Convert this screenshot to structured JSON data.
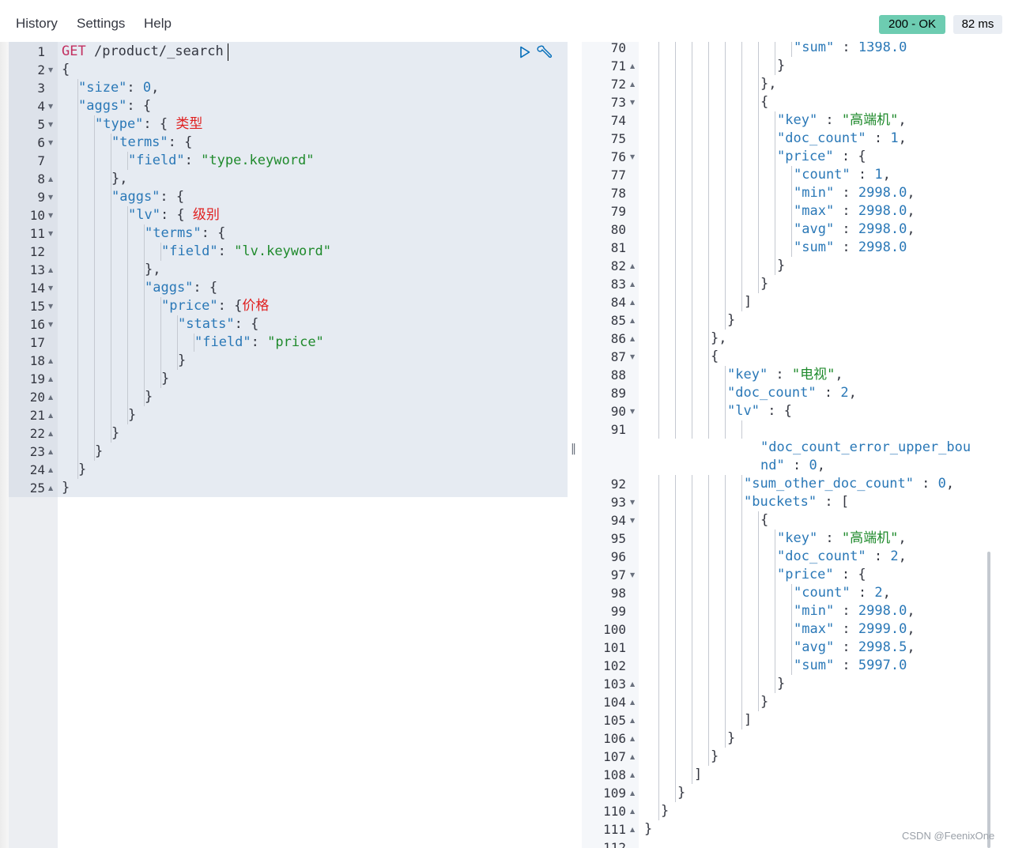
{
  "menu": {
    "history": "History",
    "settings": "Settings",
    "help": "Help"
  },
  "status": {
    "code_text": "200 - OK",
    "time_text": "82 ms"
  },
  "watermark": "CSDN @FeenixOne",
  "request": {
    "lines": [
      {
        "n": "1",
        "fold": "",
        "ind": 0,
        "tokens": [
          [
            "m",
            "GET"
          ],
          [
            "p",
            " "
          ],
          [
            "url",
            "/product/_search"
          ]
        ]
      },
      {
        "n": "2",
        "fold": "open",
        "ind": 0,
        "tokens": [
          [
            "p",
            "{"
          ]
        ]
      },
      {
        "n": "3",
        "fold": "",
        "ind": 1,
        "tokens": [
          [
            "k",
            "\"size\""
          ],
          [
            "p",
            ": "
          ],
          [
            "n",
            "0"
          ],
          [
            "p",
            ","
          ]
        ]
      },
      {
        "n": "4",
        "fold": "open",
        "ind": 1,
        "tokens": [
          [
            "k",
            "\"aggs\""
          ],
          [
            "p",
            ": {"
          ]
        ]
      },
      {
        "n": "5",
        "fold": "open",
        "ind": 2,
        "tokens": [
          [
            "k",
            "\"type\""
          ],
          [
            "p",
            ": { "
          ],
          [
            "cn",
            "类型"
          ]
        ]
      },
      {
        "n": "6",
        "fold": "open",
        "ind": 3,
        "tokens": [
          [
            "k",
            "\"terms\""
          ],
          [
            "p",
            ": {"
          ]
        ]
      },
      {
        "n": "7",
        "fold": "",
        "ind": 4,
        "tokens": [
          [
            "k",
            "\"field\""
          ],
          [
            "p",
            ": "
          ],
          [
            "s",
            "\"type.keyword\""
          ]
        ]
      },
      {
        "n": "8",
        "fold": "close",
        "ind": 3,
        "tokens": [
          [
            "p",
            "},"
          ]
        ]
      },
      {
        "n": "9",
        "fold": "open",
        "ind": 3,
        "tokens": [
          [
            "k",
            "\"aggs\""
          ],
          [
            "p",
            ": {"
          ]
        ]
      },
      {
        "n": "10",
        "fold": "open",
        "ind": 4,
        "tokens": [
          [
            "k",
            "\"lv\""
          ],
          [
            "p",
            ": { "
          ],
          [
            "cn",
            "级别"
          ]
        ]
      },
      {
        "n": "11",
        "fold": "open",
        "ind": 5,
        "tokens": [
          [
            "k",
            "\"terms\""
          ],
          [
            "p",
            ": {"
          ]
        ]
      },
      {
        "n": "12",
        "fold": "",
        "ind": 6,
        "tokens": [
          [
            "k",
            "\"field\""
          ],
          [
            "p",
            ": "
          ],
          [
            "s",
            "\"lv.keyword\""
          ]
        ]
      },
      {
        "n": "13",
        "fold": "close",
        "ind": 5,
        "tokens": [
          [
            "p",
            "},"
          ]
        ]
      },
      {
        "n": "14",
        "fold": "open",
        "ind": 5,
        "tokens": [
          [
            "k",
            "\"aggs\""
          ],
          [
            "p",
            ": {"
          ]
        ]
      },
      {
        "n": "15",
        "fold": "open",
        "ind": 6,
        "tokens": [
          [
            "k",
            "\"price\""
          ],
          [
            "p",
            ": {"
          ],
          [
            "cn",
            "价格"
          ]
        ]
      },
      {
        "n": "16",
        "fold": "open",
        "ind": 7,
        "tokens": [
          [
            "k",
            "\"stats\""
          ],
          [
            "p",
            ": {"
          ]
        ]
      },
      {
        "n": "17",
        "fold": "",
        "ind": 8,
        "tokens": [
          [
            "k",
            "\"field\""
          ],
          [
            "p",
            ": "
          ],
          [
            "s",
            "\"price\""
          ]
        ]
      },
      {
        "n": "18",
        "fold": "close",
        "ind": 7,
        "tokens": [
          [
            "p",
            "}"
          ]
        ]
      },
      {
        "n": "19",
        "fold": "close",
        "ind": 6,
        "tokens": [
          [
            "p",
            "}"
          ]
        ]
      },
      {
        "n": "20",
        "fold": "close",
        "ind": 5,
        "tokens": [
          [
            "p",
            "}"
          ]
        ]
      },
      {
        "n": "21",
        "fold": "close",
        "ind": 4,
        "tokens": [
          [
            "p",
            "}"
          ]
        ]
      },
      {
        "n": "22",
        "fold": "close",
        "ind": 3,
        "tokens": [
          [
            "p",
            "}"
          ]
        ]
      },
      {
        "n": "23",
        "fold": "close",
        "ind": 2,
        "tokens": [
          [
            "p",
            "}"
          ]
        ]
      },
      {
        "n": "24",
        "fold": "close",
        "ind": 1,
        "tokens": [
          [
            "p",
            "}"
          ]
        ]
      },
      {
        "n": "25",
        "fold": "close",
        "ind": 0,
        "tokens": [
          [
            "p",
            "}"
          ]
        ]
      }
    ]
  },
  "response": {
    "lines": [
      {
        "n": "70",
        "fold": "",
        "ind": 9,
        "tokens": [
          [
            "k",
            "\"sum\""
          ],
          [
            "p",
            " : "
          ],
          [
            "n",
            "1398.0"
          ]
        ]
      },
      {
        "n": "71",
        "fold": "close",
        "ind": 8,
        "tokens": [
          [
            "p",
            "}"
          ]
        ]
      },
      {
        "n": "72",
        "fold": "close",
        "ind": 7,
        "tokens": [
          [
            "p",
            "},"
          ]
        ]
      },
      {
        "n": "73",
        "fold": "open",
        "ind": 7,
        "tokens": [
          [
            "p",
            "{"
          ]
        ]
      },
      {
        "n": "74",
        "fold": "",
        "ind": 8,
        "tokens": [
          [
            "k",
            "\"key\""
          ],
          [
            "p",
            " : "
          ],
          [
            "s",
            "\"高端机\""
          ],
          [
            "p",
            ","
          ]
        ]
      },
      {
        "n": "75",
        "fold": "",
        "ind": 8,
        "tokens": [
          [
            "k",
            "\"doc_count\""
          ],
          [
            "p",
            " : "
          ],
          [
            "n",
            "1"
          ],
          [
            "p",
            ","
          ]
        ]
      },
      {
        "n": "76",
        "fold": "open",
        "ind": 8,
        "tokens": [
          [
            "k",
            "\"price\""
          ],
          [
            "p",
            " : {"
          ]
        ]
      },
      {
        "n": "77",
        "fold": "",
        "ind": 9,
        "tokens": [
          [
            "k",
            "\"count\""
          ],
          [
            "p",
            " : "
          ],
          [
            "n",
            "1"
          ],
          [
            "p",
            ","
          ]
        ]
      },
      {
        "n": "78",
        "fold": "",
        "ind": 9,
        "tokens": [
          [
            "k",
            "\"min\""
          ],
          [
            "p",
            " : "
          ],
          [
            "n",
            "2998.0"
          ],
          [
            "p",
            ","
          ]
        ]
      },
      {
        "n": "79",
        "fold": "",
        "ind": 9,
        "tokens": [
          [
            "k",
            "\"max\""
          ],
          [
            "p",
            " : "
          ],
          [
            "n",
            "2998.0"
          ],
          [
            "p",
            ","
          ]
        ]
      },
      {
        "n": "80",
        "fold": "",
        "ind": 9,
        "tokens": [
          [
            "k",
            "\"avg\""
          ],
          [
            "p",
            " : "
          ],
          [
            "n",
            "2998.0"
          ],
          [
            "p",
            ","
          ]
        ]
      },
      {
        "n": "81",
        "fold": "",
        "ind": 9,
        "tokens": [
          [
            "k",
            "\"sum\""
          ],
          [
            "p",
            " : "
          ],
          [
            "n",
            "2998.0"
          ]
        ]
      },
      {
        "n": "82",
        "fold": "close",
        "ind": 8,
        "tokens": [
          [
            "p",
            "}"
          ]
        ]
      },
      {
        "n": "83",
        "fold": "close",
        "ind": 7,
        "tokens": [
          [
            "p",
            "}"
          ]
        ]
      },
      {
        "n": "84",
        "fold": "close",
        "ind": 6,
        "tokens": [
          [
            "p",
            "]"
          ]
        ]
      },
      {
        "n": "85",
        "fold": "close",
        "ind": 5,
        "tokens": [
          [
            "p",
            "}"
          ]
        ]
      },
      {
        "n": "86",
        "fold": "close",
        "ind": 4,
        "tokens": [
          [
            "p",
            "},"
          ]
        ]
      },
      {
        "n": "87",
        "fold": "open",
        "ind": 4,
        "tokens": [
          [
            "p",
            "{"
          ]
        ]
      },
      {
        "n": "88",
        "fold": "",
        "ind": 5,
        "tokens": [
          [
            "k",
            "\"key\""
          ],
          [
            "p",
            " : "
          ],
          [
            "s",
            "\"电视\""
          ],
          [
            "p",
            ","
          ]
        ]
      },
      {
        "n": "89",
        "fold": "",
        "ind": 5,
        "tokens": [
          [
            "k",
            "\"doc_count\""
          ],
          [
            "p",
            " : "
          ],
          [
            "n",
            "2"
          ],
          [
            "p",
            ","
          ]
        ]
      },
      {
        "n": "90",
        "fold": "open",
        "ind": 5,
        "tokens": [
          [
            "k",
            "\"lv\""
          ],
          [
            "p",
            " : {"
          ]
        ]
      },
      {
        "n": "91",
        "fold": "",
        "ind": 6,
        "tokens": [],
        "guides_only": true
      },
      {
        "n": "",
        "fold": "",
        "ind": 7,
        "tokens": [
          [
            "k",
            "\"doc_count_error_upper_bou"
          ]
        ],
        "noguide": true
      },
      {
        "n": "",
        "fold": "",
        "ind": 7,
        "tokens": [
          [
            "k",
            "nd\""
          ],
          [
            "p",
            " : "
          ],
          [
            "n",
            "0"
          ],
          [
            "p",
            ","
          ]
        ],
        "noguide": true
      },
      {
        "n": "92",
        "fold": "",
        "ind": 6,
        "tokens": [
          [
            "k",
            "\"sum_other_doc_count\""
          ],
          [
            "p",
            " : "
          ],
          [
            "n",
            "0"
          ],
          [
            "p",
            ","
          ]
        ]
      },
      {
        "n": "93",
        "fold": "open",
        "ind": 6,
        "tokens": [
          [
            "k",
            "\"buckets\""
          ],
          [
            "p",
            " : ["
          ]
        ]
      },
      {
        "n": "94",
        "fold": "open",
        "ind": 7,
        "tokens": [
          [
            "p",
            "{"
          ]
        ]
      },
      {
        "n": "95",
        "fold": "",
        "ind": 8,
        "tokens": [
          [
            "k",
            "\"key\""
          ],
          [
            "p",
            " : "
          ],
          [
            "s",
            "\"高端机\""
          ],
          [
            "p",
            ","
          ]
        ]
      },
      {
        "n": "96",
        "fold": "",
        "ind": 8,
        "tokens": [
          [
            "k",
            "\"doc_count\""
          ],
          [
            "p",
            " : "
          ],
          [
            "n",
            "2"
          ],
          [
            "p",
            ","
          ]
        ]
      },
      {
        "n": "97",
        "fold": "open",
        "ind": 8,
        "tokens": [
          [
            "k",
            "\"price\""
          ],
          [
            "p",
            " : {"
          ]
        ]
      },
      {
        "n": "98",
        "fold": "",
        "ind": 9,
        "tokens": [
          [
            "k",
            "\"count\""
          ],
          [
            "p",
            " : "
          ],
          [
            "n",
            "2"
          ],
          [
            "p",
            ","
          ]
        ]
      },
      {
        "n": "99",
        "fold": "",
        "ind": 9,
        "tokens": [
          [
            "k",
            "\"min\""
          ],
          [
            "p",
            " : "
          ],
          [
            "n",
            "2998.0"
          ],
          [
            "p",
            ","
          ]
        ]
      },
      {
        "n": "100",
        "fold": "",
        "ind": 9,
        "tokens": [
          [
            "k",
            "\"max\""
          ],
          [
            "p",
            " : "
          ],
          [
            "n",
            "2999.0"
          ],
          [
            "p",
            ","
          ]
        ]
      },
      {
        "n": "101",
        "fold": "",
        "ind": 9,
        "tokens": [
          [
            "k",
            "\"avg\""
          ],
          [
            "p",
            " : "
          ],
          [
            "n",
            "2998.5"
          ],
          [
            "p",
            ","
          ]
        ]
      },
      {
        "n": "102",
        "fold": "",
        "ind": 9,
        "tokens": [
          [
            "k",
            "\"sum\""
          ],
          [
            "p",
            " : "
          ],
          [
            "n",
            "5997.0"
          ]
        ]
      },
      {
        "n": "103",
        "fold": "close",
        "ind": 8,
        "tokens": [
          [
            "p",
            "}"
          ]
        ]
      },
      {
        "n": "104",
        "fold": "close",
        "ind": 7,
        "tokens": [
          [
            "p",
            "}"
          ]
        ]
      },
      {
        "n": "105",
        "fold": "close",
        "ind": 6,
        "tokens": [
          [
            "p",
            "]"
          ]
        ]
      },
      {
        "n": "106",
        "fold": "close",
        "ind": 5,
        "tokens": [
          [
            "p",
            "}"
          ]
        ]
      },
      {
        "n": "107",
        "fold": "close",
        "ind": 4,
        "tokens": [
          [
            "p",
            "}"
          ]
        ]
      },
      {
        "n": "108",
        "fold": "close",
        "ind": 3,
        "tokens": [
          [
            "p",
            "]"
          ]
        ]
      },
      {
        "n": "109",
        "fold": "close",
        "ind": 2,
        "tokens": [
          [
            "p",
            "}"
          ]
        ]
      },
      {
        "n": "110",
        "fold": "close",
        "ind": 1,
        "tokens": [
          [
            "p",
            "}"
          ]
        ]
      },
      {
        "n": "111",
        "fold": "close",
        "ind": 0,
        "tokens": [
          [
            "p",
            "}"
          ]
        ]
      },
      {
        "n": "112",
        "fold": "",
        "ind": 0,
        "tokens": []
      }
    ]
  }
}
